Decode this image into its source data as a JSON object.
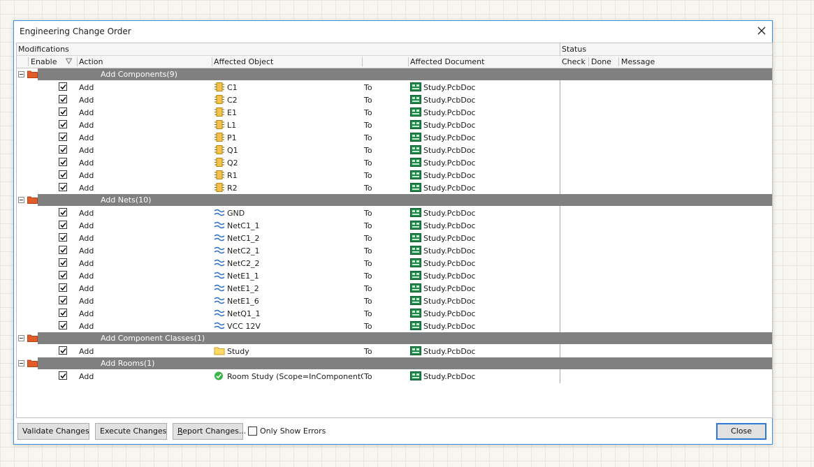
{
  "dialog": {
    "title": "Engineering Change Order",
    "close_icon": "close-icon",
    "header": {
      "modifications": "Modifications",
      "status": "Status",
      "enable": "Enable",
      "action": "Action",
      "affected_object": "Affected Object",
      "affected_document": "Affected Document",
      "check": "Check",
      "done": "Done",
      "message": "Message"
    },
    "groups": [
      {
        "label": "Add Components(9)",
        "rows": [
          {
            "action": "Add",
            "object": "C1",
            "to": "To",
            "document": "Study.PcbDoc",
            "icon": "component-icon"
          },
          {
            "action": "Add",
            "object": "C2",
            "to": "To",
            "document": "Study.PcbDoc",
            "icon": "component-icon"
          },
          {
            "action": "Add",
            "object": "E1",
            "to": "To",
            "document": "Study.PcbDoc",
            "icon": "component-icon"
          },
          {
            "action": "Add",
            "object": "L1",
            "to": "To",
            "document": "Study.PcbDoc",
            "icon": "component-icon"
          },
          {
            "action": "Add",
            "object": "P1",
            "to": "To",
            "document": "Study.PcbDoc",
            "icon": "component-icon"
          },
          {
            "action": "Add",
            "object": "Q1",
            "to": "To",
            "document": "Study.PcbDoc",
            "icon": "component-icon"
          },
          {
            "action": "Add",
            "object": "Q2",
            "to": "To",
            "document": "Study.PcbDoc",
            "icon": "component-icon"
          },
          {
            "action": "Add",
            "object": "R1",
            "to": "To",
            "document": "Study.PcbDoc",
            "icon": "component-icon"
          },
          {
            "action": "Add",
            "object": "R2",
            "to": "To",
            "document": "Study.PcbDoc",
            "icon": "component-icon"
          }
        ]
      },
      {
        "label": "Add Nets(10)",
        "rows": [
          {
            "action": "Add",
            "object": "GND",
            "to": "To",
            "document": "Study.PcbDoc",
            "icon": "net-icon"
          },
          {
            "action": "Add",
            "object": "NetC1_1",
            "to": "To",
            "document": "Study.PcbDoc",
            "icon": "net-icon"
          },
          {
            "action": "Add",
            "object": "NetC1_2",
            "to": "To",
            "document": "Study.PcbDoc",
            "icon": "net-icon"
          },
          {
            "action": "Add",
            "object": "NetC2_1",
            "to": "To",
            "document": "Study.PcbDoc",
            "icon": "net-icon"
          },
          {
            "action": "Add",
            "object": "NetC2_2",
            "to": "To",
            "document": "Study.PcbDoc",
            "icon": "net-icon"
          },
          {
            "action": "Add",
            "object": "NetE1_1",
            "to": "To",
            "document": "Study.PcbDoc",
            "icon": "net-icon"
          },
          {
            "action": "Add",
            "object": "NetE1_2",
            "to": "To",
            "document": "Study.PcbDoc",
            "icon": "net-icon"
          },
          {
            "action": "Add",
            "object": "NetE1_6",
            "to": "To",
            "document": "Study.PcbDoc",
            "icon": "net-icon"
          },
          {
            "action": "Add",
            "object": "NetQ1_1",
            "to": "To",
            "document": "Study.PcbDoc",
            "icon": "net-icon"
          },
          {
            "action": "Add",
            "object": "VCC 12V",
            "to": "To",
            "document": "Study.PcbDoc",
            "icon": "net-icon"
          }
        ]
      },
      {
        "label": "Add Component Classes(1)",
        "rows": [
          {
            "action": "Add",
            "object": "Study",
            "to": "To",
            "document": "Study.PcbDoc",
            "icon": "folder-icon"
          }
        ]
      },
      {
        "label": "Add Rooms(1)",
        "rows": [
          {
            "action": "Add",
            "object": "Room Study (Scope=InComponentCla",
            "to": "To",
            "document": "Study.PcbDoc",
            "icon": "room-icon"
          }
        ]
      }
    ],
    "footer": {
      "validate": "Validate Changes",
      "execute": "Execute Changes",
      "report_prefix": "R",
      "report_rest": "eport Changes...",
      "only_show_errors": "Only Show Errors",
      "close": "Close"
    },
    "colors": {
      "group_bar": "#808080",
      "accent": "#2d7ad4",
      "pcb_doc": "#1e8a4a",
      "folder": "#e25c2a"
    }
  }
}
